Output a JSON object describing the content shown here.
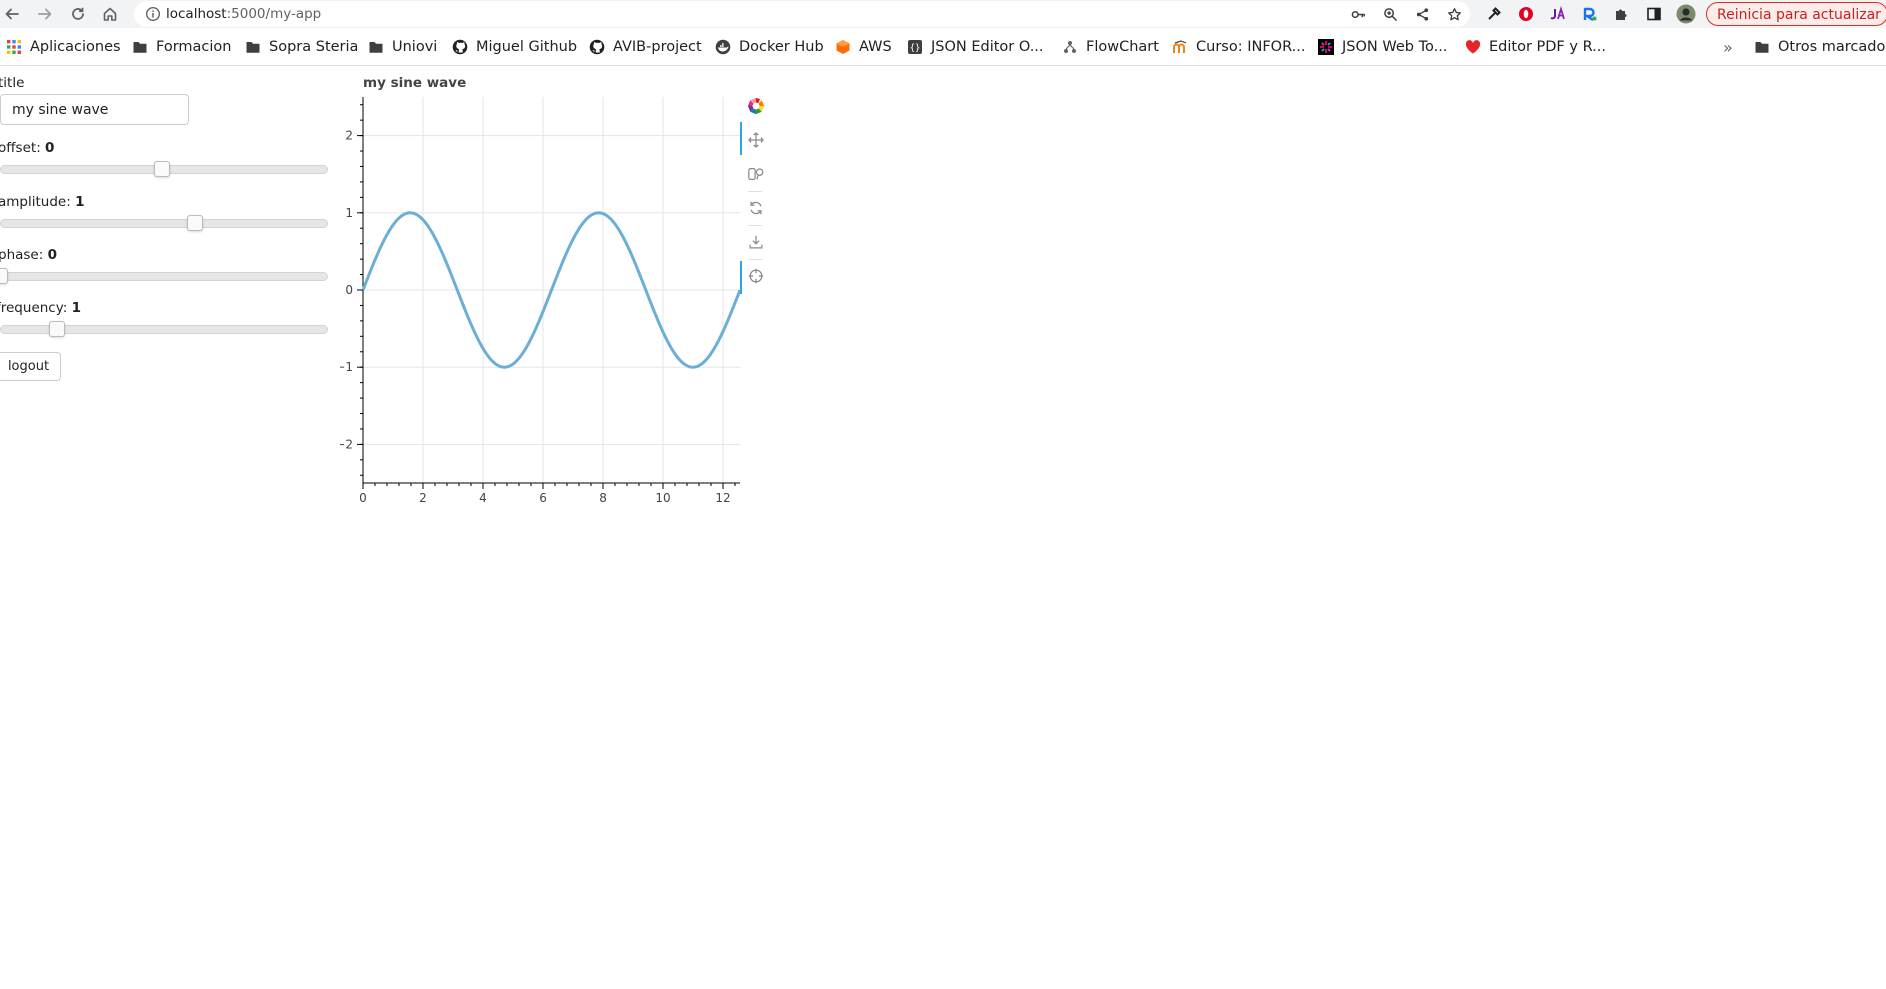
{
  "browser": {
    "url_host": "localhost",
    "url_path": ":5000/my-app",
    "update_button": "Reinicia para actualizar",
    "bookmarks": [
      {
        "label": "Aplicaciones",
        "icon": "apps-grid-icon"
      },
      {
        "label": "Formacion",
        "icon": "folder-icon"
      },
      {
        "label": "Sopra Steria",
        "icon": "folder-icon"
      },
      {
        "label": "Uniovi",
        "icon": "folder-icon"
      },
      {
        "label": "Miguel Github",
        "icon": "github-icon"
      },
      {
        "label": "AVIB-project",
        "icon": "github-icon"
      },
      {
        "label": "Docker Hub",
        "icon": "docker-icon"
      },
      {
        "label": "AWS",
        "icon": "aws-icon"
      },
      {
        "label": "JSON Editor O...",
        "icon": "json-editor-icon"
      },
      {
        "label": "FlowChart",
        "icon": "flowchart-icon"
      },
      {
        "label": "Curso: INFOR...",
        "icon": "moodle-icon"
      },
      {
        "label": "JSON Web To...",
        "icon": "jwt-icon"
      },
      {
        "label": "Editor PDF y R...",
        "icon": "pdf-heart-icon"
      }
    ],
    "more_bookmarks_chevron": "»",
    "other_bookmarks": "Otros marcadores"
  },
  "controls": {
    "title_label": "title",
    "title_value": "my sine wave",
    "sliders": [
      {
        "label": "offset",
        "value": "0",
        "min": -5,
        "max": 5,
        "current": 0
      },
      {
        "label": "amplitude",
        "value": "1",
        "min": -5,
        "max": 5,
        "current": 1
      },
      {
        "label": "phase",
        "value": "0",
        "min": 0,
        "max": 6.2832,
        "current": 0
      },
      {
        "label": "frequency",
        "value": "1",
        "min": 0.1,
        "max": 5.1,
        "current": 1
      }
    ],
    "logout_label": "logout"
  },
  "plot": {
    "title": "my sine wave"
  },
  "chart_data": {
    "type": "line",
    "title": "my sine wave",
    "xlabel": "",
    "ylabel": "",
    "xlim": [
      0,
      12.566
    ],
    "ylim": [
      -2.5,
      2.5
    ],
    "x_ticks": [
      0,
      2,
      4,
      6,
      8,
      10,
      12
    ],
    "x_tick_labels": [
      "0",
      "2",
      "4",
      "6",
      "8",
      "10",
      "12"
    ],
    "y_ticks": [
      2,
      1,
      0,
      -1,
      -2
    ],
    "y_tick_labels": [
      "2",
      "1",
      "0",
      "−1",
      "−2"
    ],
    "grid": true,
    "series": [
      {
        "function": "sin(x)",
        "offset": 0,
        "amplitude": 1,
        "phase": 0,
        "frequency": 1,
        "x_range": [
          0,
          12.566
        ],
        "color": "#6baed6"
      }
    ]
  },
  "toolbar": {
    "tools": [
      "bokeh-logo-icon",
      "pan-icon",
      "box-zoom-icon",
      "reset-icon",
      "save-icon",
      "hover-icon"
    ]
  }
}
